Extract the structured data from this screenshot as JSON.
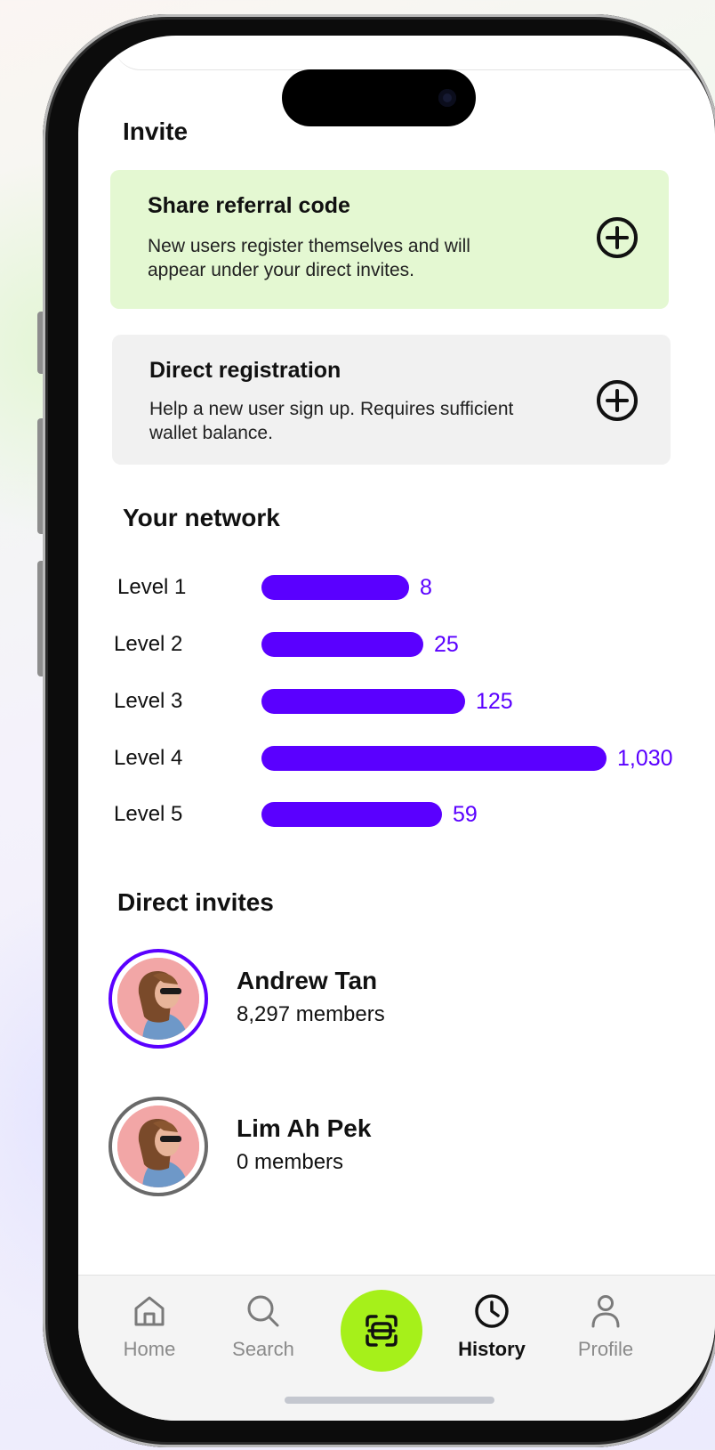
{
  "invite": {
    "title": "Invite",
    "referral": {
      "title": "Share referral code",
      "description": "New users register themselves and will appear under your direct invites."
    },
    "direct": {
      "title": "Direct registration",
      "description": "Help a new user sign up. Requires sufficient wallet balance."
    }
  },
  "network": {
    "title": "Your network",
    "levels": [
      {
        "label": "Level 1",
        "value_text": "8",
        "value": 8
      },
      {
        "label": "Level 2",
        "value_text": "25",
        "value": 25
      },
      {
        "label": "Level 3",
        "value_text": "125",
        "value": 125
      },
      {
        "label": "Level 4",
        "value_text": "1,030",
        "value": 1030
      },
      {
        "label": "Level 5",
        "value_text": "59",
        "value": 59
      }
    ],
    "accent_color": "#5a00ff"
  },
  "direct_invites": {
    "title": "Direct invites",
    "people": [
      {
        "name": "Andrew Tan",
        "members": "8,297 members"
      },
      {
        "name": "Lim Ah Pek",
        "members": "0 members"
      }
    ]
  },
  "tabbar": {
    "home": "Home",
    "search": "Search",
    "history": "History",
    "profile": "Profile",
    "active": "history",
    "scan_color": "#a6f01a"
  }
}
